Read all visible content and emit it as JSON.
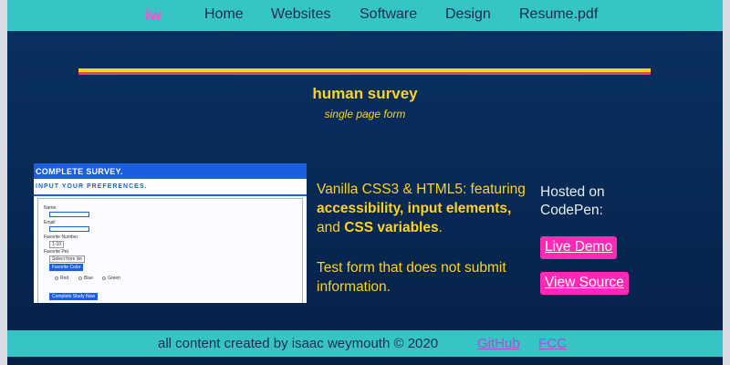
{
  "nav": {
    "logo": "iw",
    "links": [
      "Home",
      "Websites",
      "Software",
      "Design",
      "Resume.pdf"
    ]
  },
  "header": {
    "title": "human survey",
    "subtitle": "single page form"
  },
  "thumbnail": {
    "heading": "COMPLETE SURVEY.",
    "subheading": "INPUT YOUR PREFERENCES.",
    "fields": [
      "Name",
      "Email",
      "Favorite Number",
      "Favorite Pet"
    ],
    "number_value": "1-10",
    "select_value": "Select from list",
    "color_label": "Favorite Color",
    "radios": [
      "Red",
      "Blue",
      "Green"
    ],
    "submit_label": "Complete Study Now"
  },
  "description": {
    "intro": "Vanilla CSS3 & HTML5: featuring",
    "kw1": "accessibility,",
    "kw2": "input elements,",
    "and": "and",
    "kw3": "CSS variables",
    "end": ".",
    "para2": "Test form that does not submit information."
  },
  "hosted": {
    "text": "Hosted on CodePen:",
    "demo_label": "Live Demo",
    "source_label": "View Source"
  },
  "footer": {
    "credit": "all content created by isaac weymouth © 2020",
    "github": "GitHub",
    "fcc": "FCC"
  },
  "colors": {
    "nav_bg": "#36c5c5",
    "accent_yellow": "#ffd21c",
    "accent_pink": "#ff29b8",
    "page_bg": "#0a3163"
  }
}
